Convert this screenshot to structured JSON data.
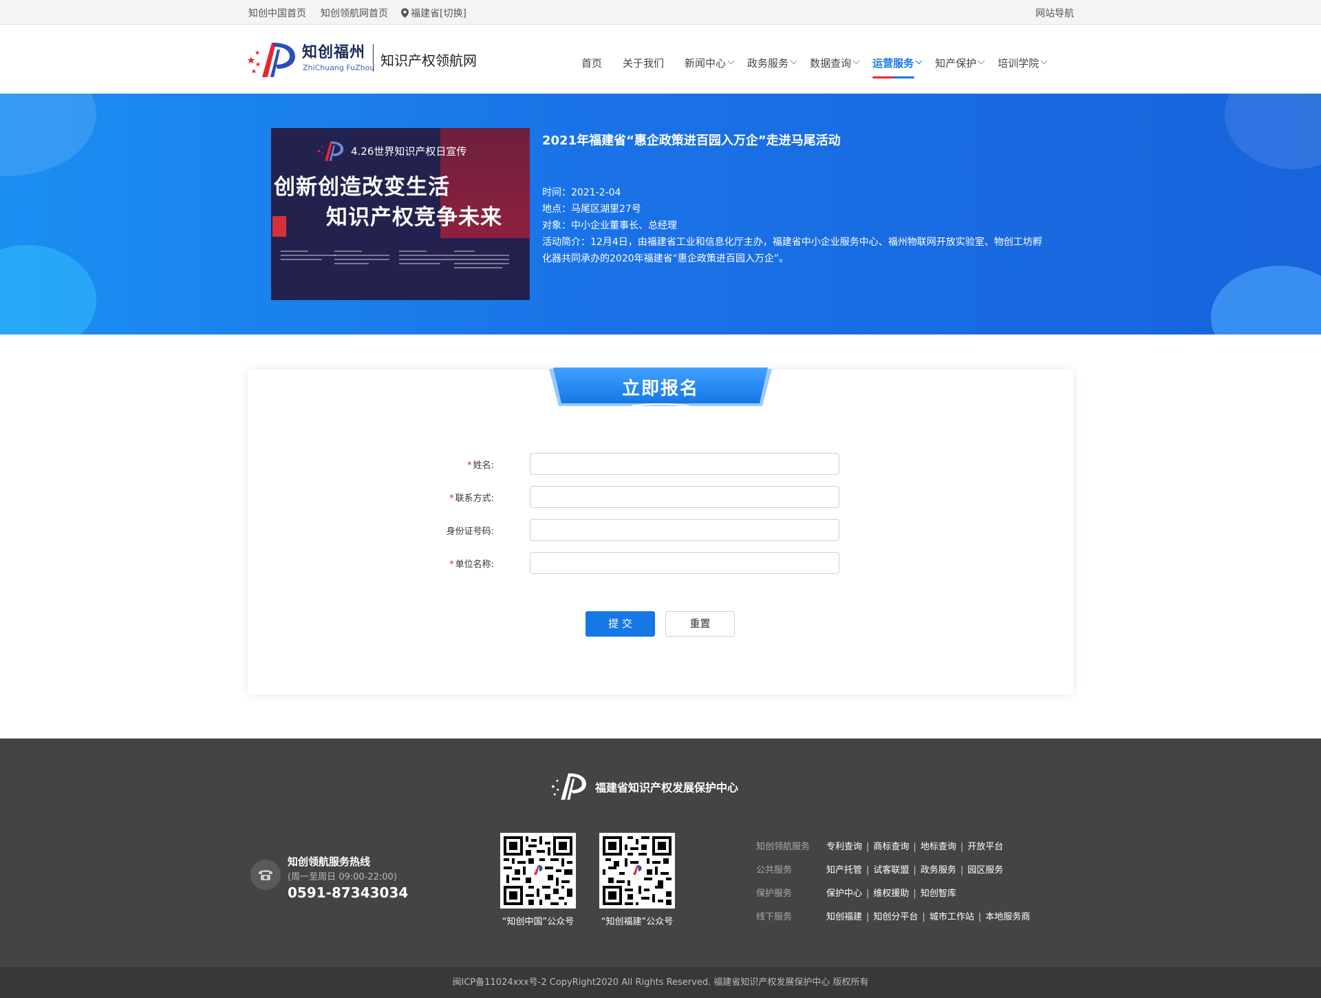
{
  "topbar": {
    "link1": "知创中国首页",
    "link2": "知创领航网首页",
    "location": "福建省",
    "switch_label": "[切换]",
    "site_nav": "网站导航"
  },
  "header": {
    "brand_cn": "知创福州",
    "brand_en": "ZhiChuang FuZhou",
    "site_name": "知识产权领航网",
    "nav": [
      {
        "label": "首页",
        "dropdown": false,
        "active": false
      },
      {
        "label": "关于我们",
        "dropdown": false,
        "active": false
      },
      {
        "label": "新闻中心",
        "dropdown": true,
        "active": false
      },
      {
        "label": "政务服务",
        "dropdown": true,
        "active": false
      },
      {
        "label": "数据查询",
        "dropdown": true,
        "active": false
      },
      {
        "label": "运营服务",
        "dropdown": true,
        "active": true
      },
      {
        "label": "知产保护",
        "dropdown": true,
        "active": false
      },
      {
        "label": "培训学院",
        "dropdown": true,
        "active": false
      }
    ]
  },
  "banner": {
    "poster": {
      "title": "4.26世界知识产权日宣传",
      "line1": "创新创造改变生活",
      "line2": "知识产权竞争未来"
    },
    "event_title": "2021年福建省“惠企政策进百园入万企”走进马尾活动",
    "time": "时间：2021-2-04",
    "place": "地点：马尾区湖里27号",
    "audience": "对象：中小企业董事长、总经理",
    "intro": "活动简介：12月4日，由福建省工业和信息化厅主办，福建省中小企业服务中心、福州物联网开放实验室、物创工坊孵化器共同承办的2020年福建省“惠企政策进百园入万企”。"
  },
  "form": {
    "title": "立即报名",
    "fields": [
      {
        "label": "姓名:",
        "required": true,
        "value": ""
      },
      {
        "label": "联系方式:",
        "required": true,
        "value": ""
      },
      {
        "label": "身份证号码:",
        "required": false,
        "value": ""
      },
      {
        "label": "单位名称:",
        "required": true,
        "value": ""
      }
    ],
    "submit_label": "提 交",
    "reset_label": "重置"
  },
  "footer": {
    "org_name": "福建省知识产权发展保护中心",
    "hotline_title": "知创领航服务热线",
    "hotline_hours": "(周一至周日 09:00-22:00)",
    "hotline_number": "0591-87343034",
    "qr": [
      {
        "caption": "“知创中国”公众号"
      },
      {
        "caption": "“知创福建”公众号"
      }
    ],
    "link_rows": [
      {
        "category": "知创领航服务",
        "links": [
          "专利查询",
          "商标查询",
          "地标查询",
          "开放平台"
        ]
      },
      {
        "category": "公共服务",
        "links": [
          "知产托管",
          "试客联盟",
          "政务服务",
          "园区服务"
        ]
      },
      {
        "category": "保护服务",
        "links": [
          "保护中心",
          "维权援助",
          "知创智库"
        ]
      },
      {
        "category": "线下服务",
        "links": [
          "知创福建",
          "知创分平台",
          "城市工作站",
          "本地服务商"
        ]
      }
    ],
    "copyright": "闽ICP备11024xxx号-2  CopyRight2020  All Rights Reserved.  福建省知识产权发展保护中心  版权所有"
  },
  "colors": {
    "accent": "#1677e6",
    "brand_red": "#e9262c",
    "banner_start": "#1a8ff2",
    "banner_end": "#1864dc",
    "footer_bg": "#444444"
  }
}
